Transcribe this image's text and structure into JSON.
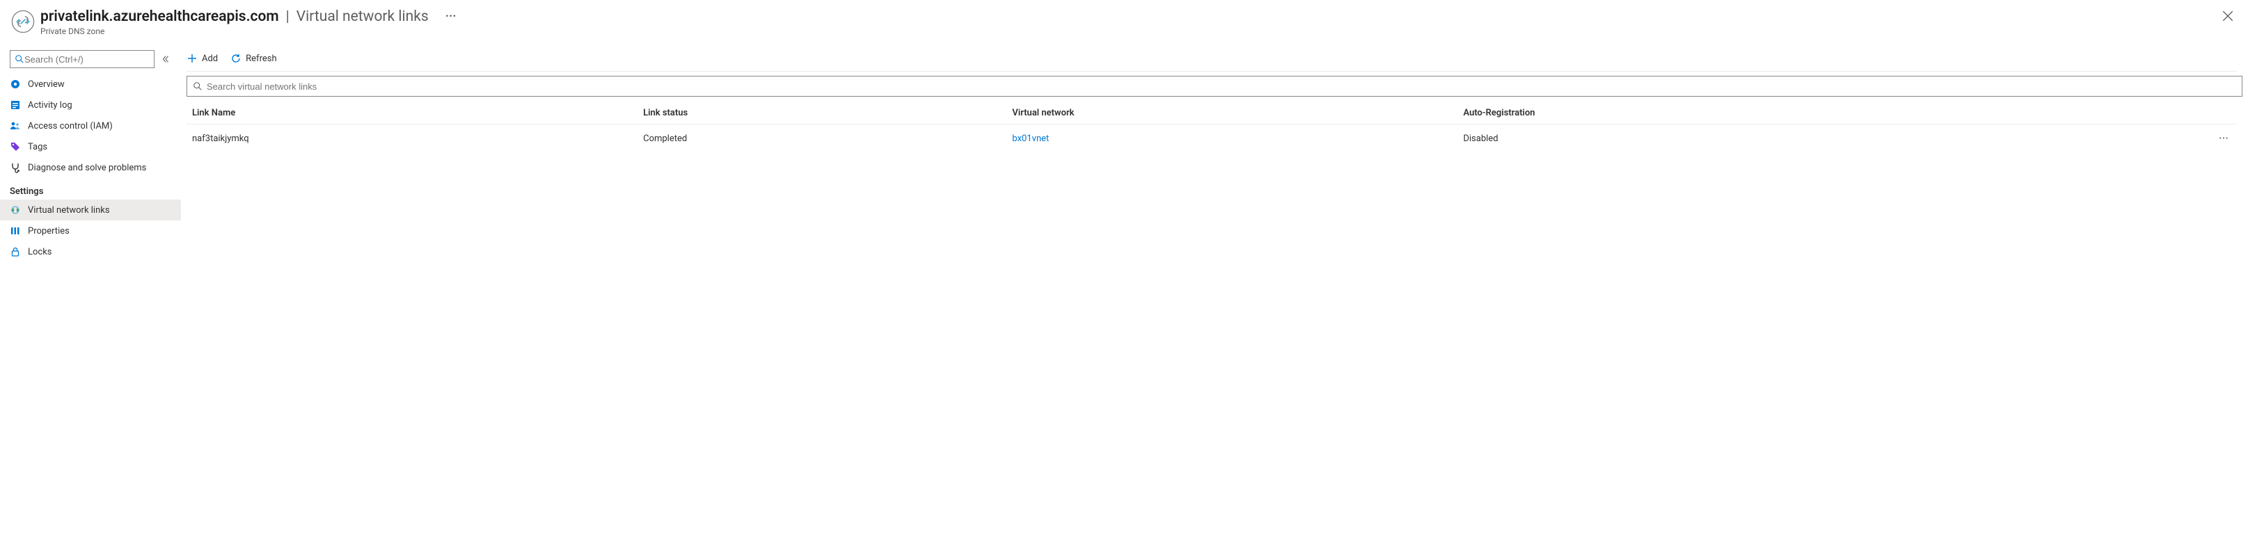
{
  "header": {
    "title_main": "privatelink.azurehealthcareapis.com",
    "title_sep": "|",
    "title_sub": "Virtual network links",
    "breadcrumb": "Private DNS zone",
    "more": "···"
  },
  "sidebar": {
    "search_placeholder": "Search (Ctrl+/)",
    "items": [
      {
        "label": "Overview"
      },
      {
        "label": "Activity log"
      },
      {
        "label": "Access control (IAM)"
      },
      {
        "label": "Tags"
      },
      {
        "label": "Diagnose and solve problems"
      }
    ],
    "group_settings": "Settings",
    "settings_items": [
      {
        "label": "Virtual network links"
      },
      {
        "label": "Properties"
      },
      {
        "label": "Locks"
      }
    ]
  },
  "toolbar": {
    "add_label": "Add",
    "refresh_label": "Refresh"
  },
  "filter": {
    "placeholder": "Search virtual network links"
  },
  "table": {
    "headers": {
      "name": "Link Name",
      "status": "Link status",
      "vnet": "Virtual network",
      "autoreg": "Auto-Registration"
    },
    "rows": [
      {
        "name": "naf3taikjymkq",
        "status": "Completed",
        "vnet": "bx01vnet",
        "autoreg": "Disabled",
        "more": "···"
      }
    ]
  }
}
